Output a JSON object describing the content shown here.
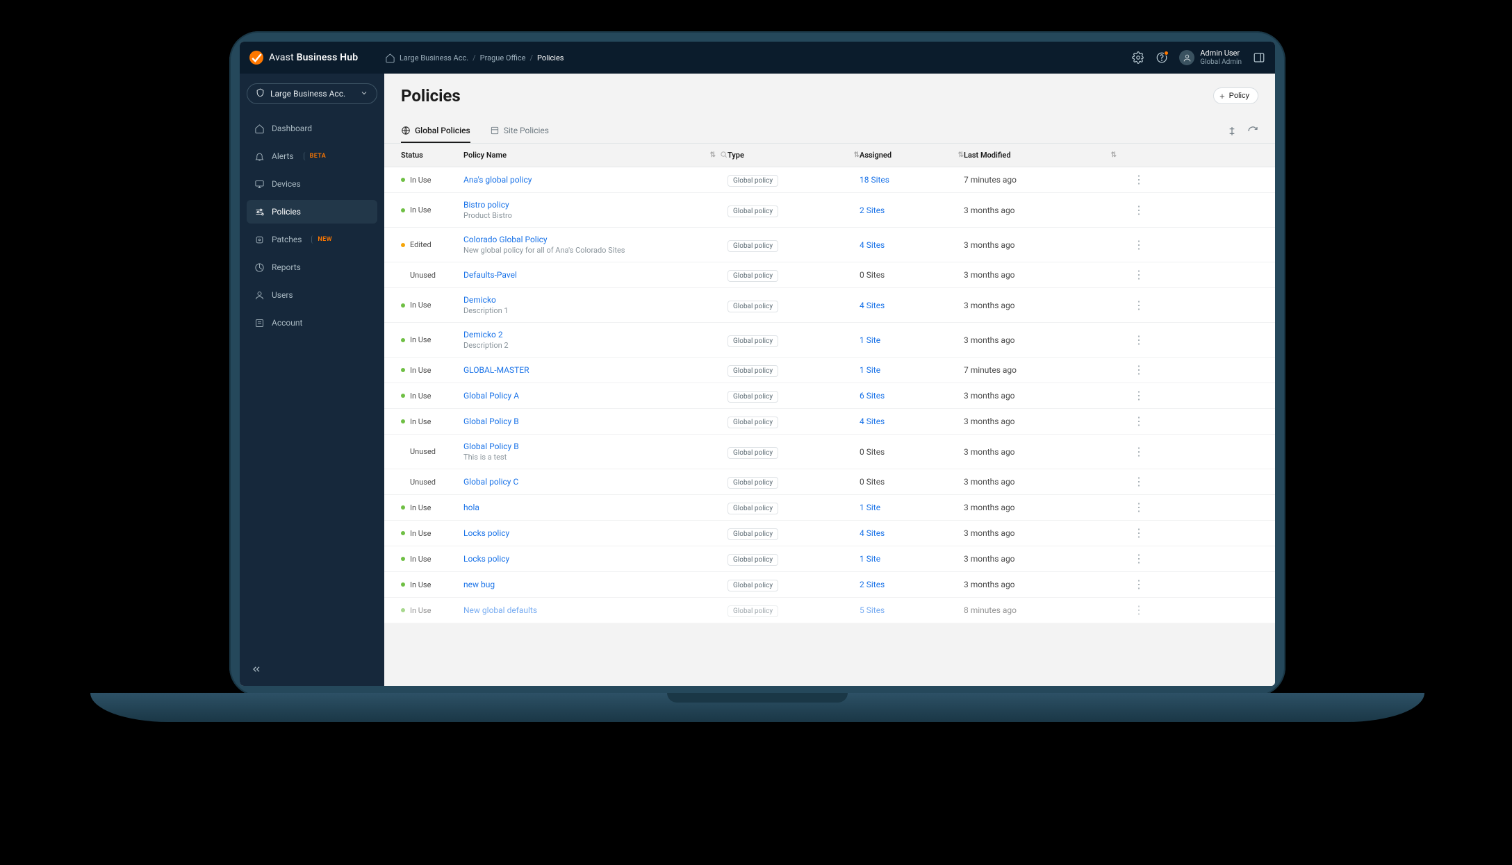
{
  "brand": {
    "name_light": "Avast ",
    "name_bold": "Business Hub"
  },
  "breadcrumb": {
    "home_icon": "home-icon",
    "parts": [
      "Large Business Acc.",
      "Prague Office"
    ],
    "current": "Policies"
  },
  "user": {
    "name": "Admin User",
    "role": "Global Admin"
  },
  "account_picker": "Large Business Acc.",
  "sidebar": {
    "items": [
      {
        "label": "Dashboard",
        "icon": "home",
        "badge": null,
        "active": false
      },
      {
        "label": "Alerts",
        "icon": "bell",
        "badge": "BETA",
        "active": false
      },
      {
        "label": "Devices",
        "icon": "monitor",
        "badge": null,
        "active": false
      },
      {
        "label": "Policies",
        "icon": "sliders",
        "badge": null,
        "active": true
      },
      {
        "label": "Patches",
        "icon": "patch",
        "badge": "NEW",
        "active": false
      },
      {
        "label": "Reports",
        "icon": "reports",
        "badge": null,
        "active": false
      },
      {
        "label": "Users",
        "icon": "user",
        "badge": null,
        "active": false
      },
      {
        "label": "Account",
        "icon": "account",
        "badge": null,
        "active": false
      }
    ]
  },
  "page": {
    "title": "Policies",
    "new_button": "Policy"
  },
  "tabs": [
    {
      "label": "Global Policies",
      "active": true
    },
    {
      "label": "Site Policies",
      "active": false
    }
  ],
  "columns": {
    "status": "Status",
    "name": "Policy Name",
    "type": "Type",
    "assigned": "Assigned",
    "modified": "Last Modified"
  },
  "type_label": "Global policy",
  "rows": [
    {
      "status": "In Use",
      "status_kind": "inuse",
      "name": "Ana's global policy",
      "desc": null,
      "type": "Global policy",
      "assigned": "18 Sites",
      "assigned_link": true,
      "modified": "7 minutes ago"
    },
    {
      "status": "In Use",
      "status_kind": "inuse",
      "name": "Bistro policy",
      "desc": "Product Bistro",
      "type": "Global policy",
      "assigned": "2 Sites",
      "assigned_link": true,
      "modified": "3 months ago"
    },
    {
      "status": "Edited",
      "status_kind": "edited",
      "name": "Colorado Global Policy",
      "desc": "New global policy for all of Ana's Colorado Sites",
      "type": "Global policy",
      "assigned": "4 Sites",
      "assigned_link": true,
      "modified": "3 months ago"
    },
    {
      "status": "Unused",
      "status_kind": "unused",
      "name": "Defaults-Pavel",
      "desc": null,
      "type": "Global policy",
      "assigned": "0 Sites",
      "assigned_link": false,
      "modified": "3 months ago"
    },
    {
      "status": "In Use",
      "status_kind": "inuse",
      "name": "Demicko",
      "desc": "Description 1",
      "type": "Global policy",
      "assigned": "4 Sites",
      "assigned_link": true,
      "modified": "3 months ago"
    },
    {
      "status": "In Use",
      "status_kind": "inuse",
      "name": "Demicko 2",
      "desc": "Description 2",
      "type": "Global policy",
      "assigned": "1 Site",
      "assigned_link": true,
      "modified": "3 months ago"
    },
    {
      "status": "In Use",
      "status_kind": "inuse",
      "name": "GLOBAL-MASTER",
      "desc": null,
      "type": "Global policy",
      "assigned": "1 Site",
      "assigned_link": true,
      "modified": "7 minutes ago"
    },
    {
      "status": "In Use",
      "status_kind": "inuse",
      "name": "Global Policy A",
      "desc": null,
      "type": "Global policy",
      "assigned": "6 Sites",
      "assigned_link": true,
      "modified": "3 months ago"
    },
    {
      "status": "In Use",
      "status_kind": "inuse",
      "name": "Global Policy B",
      "desc": null,
      "type": "Global policy",
      "assigned": "4 Sites",
      "assigned_link": true,
      "modified": "3 months ago"
    },
    {
      "status": "Unused",
      "status_kind": "unused",
      "name": "Global Policy B",
      "desc": "This is a test",
      "type": "Global policy",
      "assigned": "0 Sites",
      "assigned_link": false,
      "modified": "3 months ago"
    },
    {
      "status": "Unused",
      "status_kind": "unused",
      "name": "Global policy C",
      "desc": null,
      "type": "Global policy",
      "assigned": "0 Sites",
      "assigned_link": false,
      "modified": "3 months ago"
    },
    {
      "status": "In Use",
      "status_kind": "inuse",
      "name": "hola",
      "desc": null,
      "type": "Global policy",
      "assigned": "1 Site",
      "assigned_link": true,
      "modified": "3 months ago"
    },
    {
      "status": "In Use",
      "status_kind": "inuse",
      "name": "Locks policy",
      "desc": null,
      "type": "Global policy",
      "assigned": "4 Sites",
      "assigned_link": true,
      "modified": "3 months ago"
    },
    {
      "status": "In Use",
      "status_kind": "inuse",
      "name": "Locks policy",
      "desc": null,
      "type": "Global policy",
      "assigned": "1 Site",
      "assigned_link": true,
      "modified": "3 months ago"
    },
    {
      "status": "In Use",
      "status_kind": "inuse",
      "name": "new bug",
      "desc": null,
      "type": "Global policy",
      "assigned": "2 Sites",
      "assigned_link": true,
      "modified": "3 months ago"
    },
    {
      "status": "In Use",
      "status_kind": "inuse",
      "name": "New global defaults",
      "desc": null,
      "type": "Global policy",
      "assigned": "5 Sites",
      "assigned_link": true,
      "modified": "8 minutes ago"
    }
  ]
}
